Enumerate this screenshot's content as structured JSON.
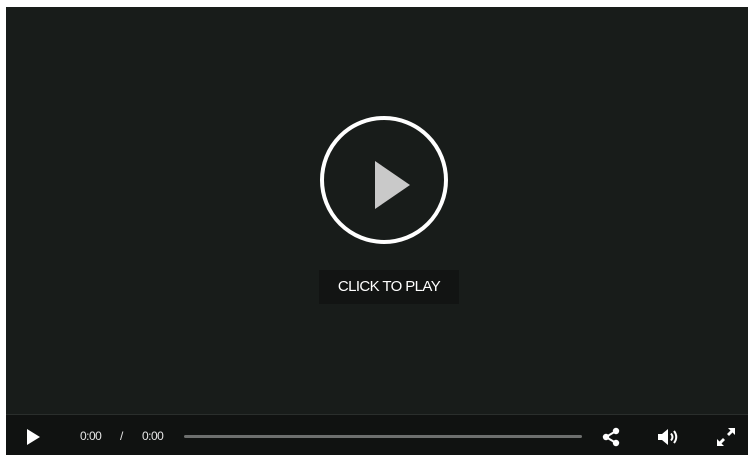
{
  "player": {
    "overlay_label": "CLICK TO PLAY",
    "controls": {
      "current_time": "0:00",
      "separator": "/",
      "duration": "0:00",
      "progress": 0
    },
    "icons": {
      "big_play": "play-circle-icon",
      "play": "play-icon",
      "share": "share-icon",
      "volume": "volume-icon",
      "fullscreen": "fullscreen-icon"
    },
    "colors": {
      "background": "#181c1a",
      "control_bar": "#101211",
      "foreground": "#ffffff",
      "track": "#6d6f6e"
    }
  }
}
